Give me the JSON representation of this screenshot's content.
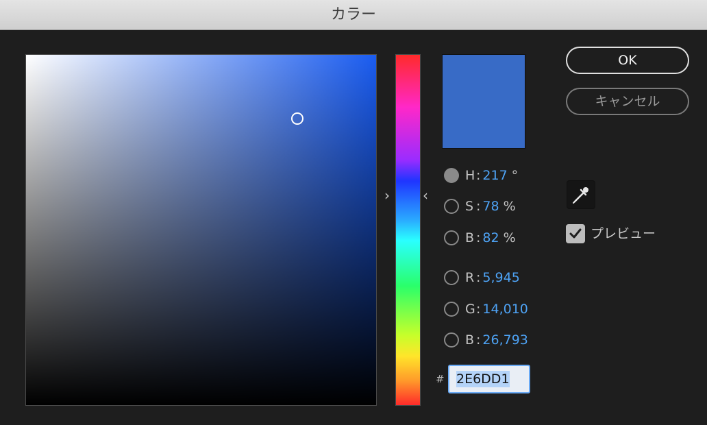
{
  "window": {
    "title": "カラー"
  },
  "picker": {
    "hue_degrees": 217,
    "saturation_pct": 78,
    "brightness_pct": 82
  },
  "swatch": {
    "color": "#386BC6"
  },
  "fields": {
    "h": {
      "label": "H",
      "value": "217",
      "unit": "°"
    },
    "s": {
      "label": "S",
      "value": "78",
      "unit": "%"
    },
    "b": {
      "label": "B",
      "value": "82",
      "unit": "%"
    },
    "r": {
      "label": "R",
      "value": "5,945"
    },
    "g": {
      "label": "G",
      "value": "14,010"
    },
    "b2": {
      "label": "B",
      "value": "26,793"
    },
    "colon": ":"
  },
  "hex": {
    "hash": "#",
    "value": "2E6DD1"
  },
  "buttons": {
    "ok": "OK",
    "cancel": "キャンセル"
  },
  "eyedropper": {
    "icon": "eyedropper-icon"
  },
  "preview": {
    "label": "プレビュー",
    "checked": true
  },
  "colors": {
    "value_accent": "#4EA3F5",
    "focus_ring": "#6AAAF5"
  }
}
